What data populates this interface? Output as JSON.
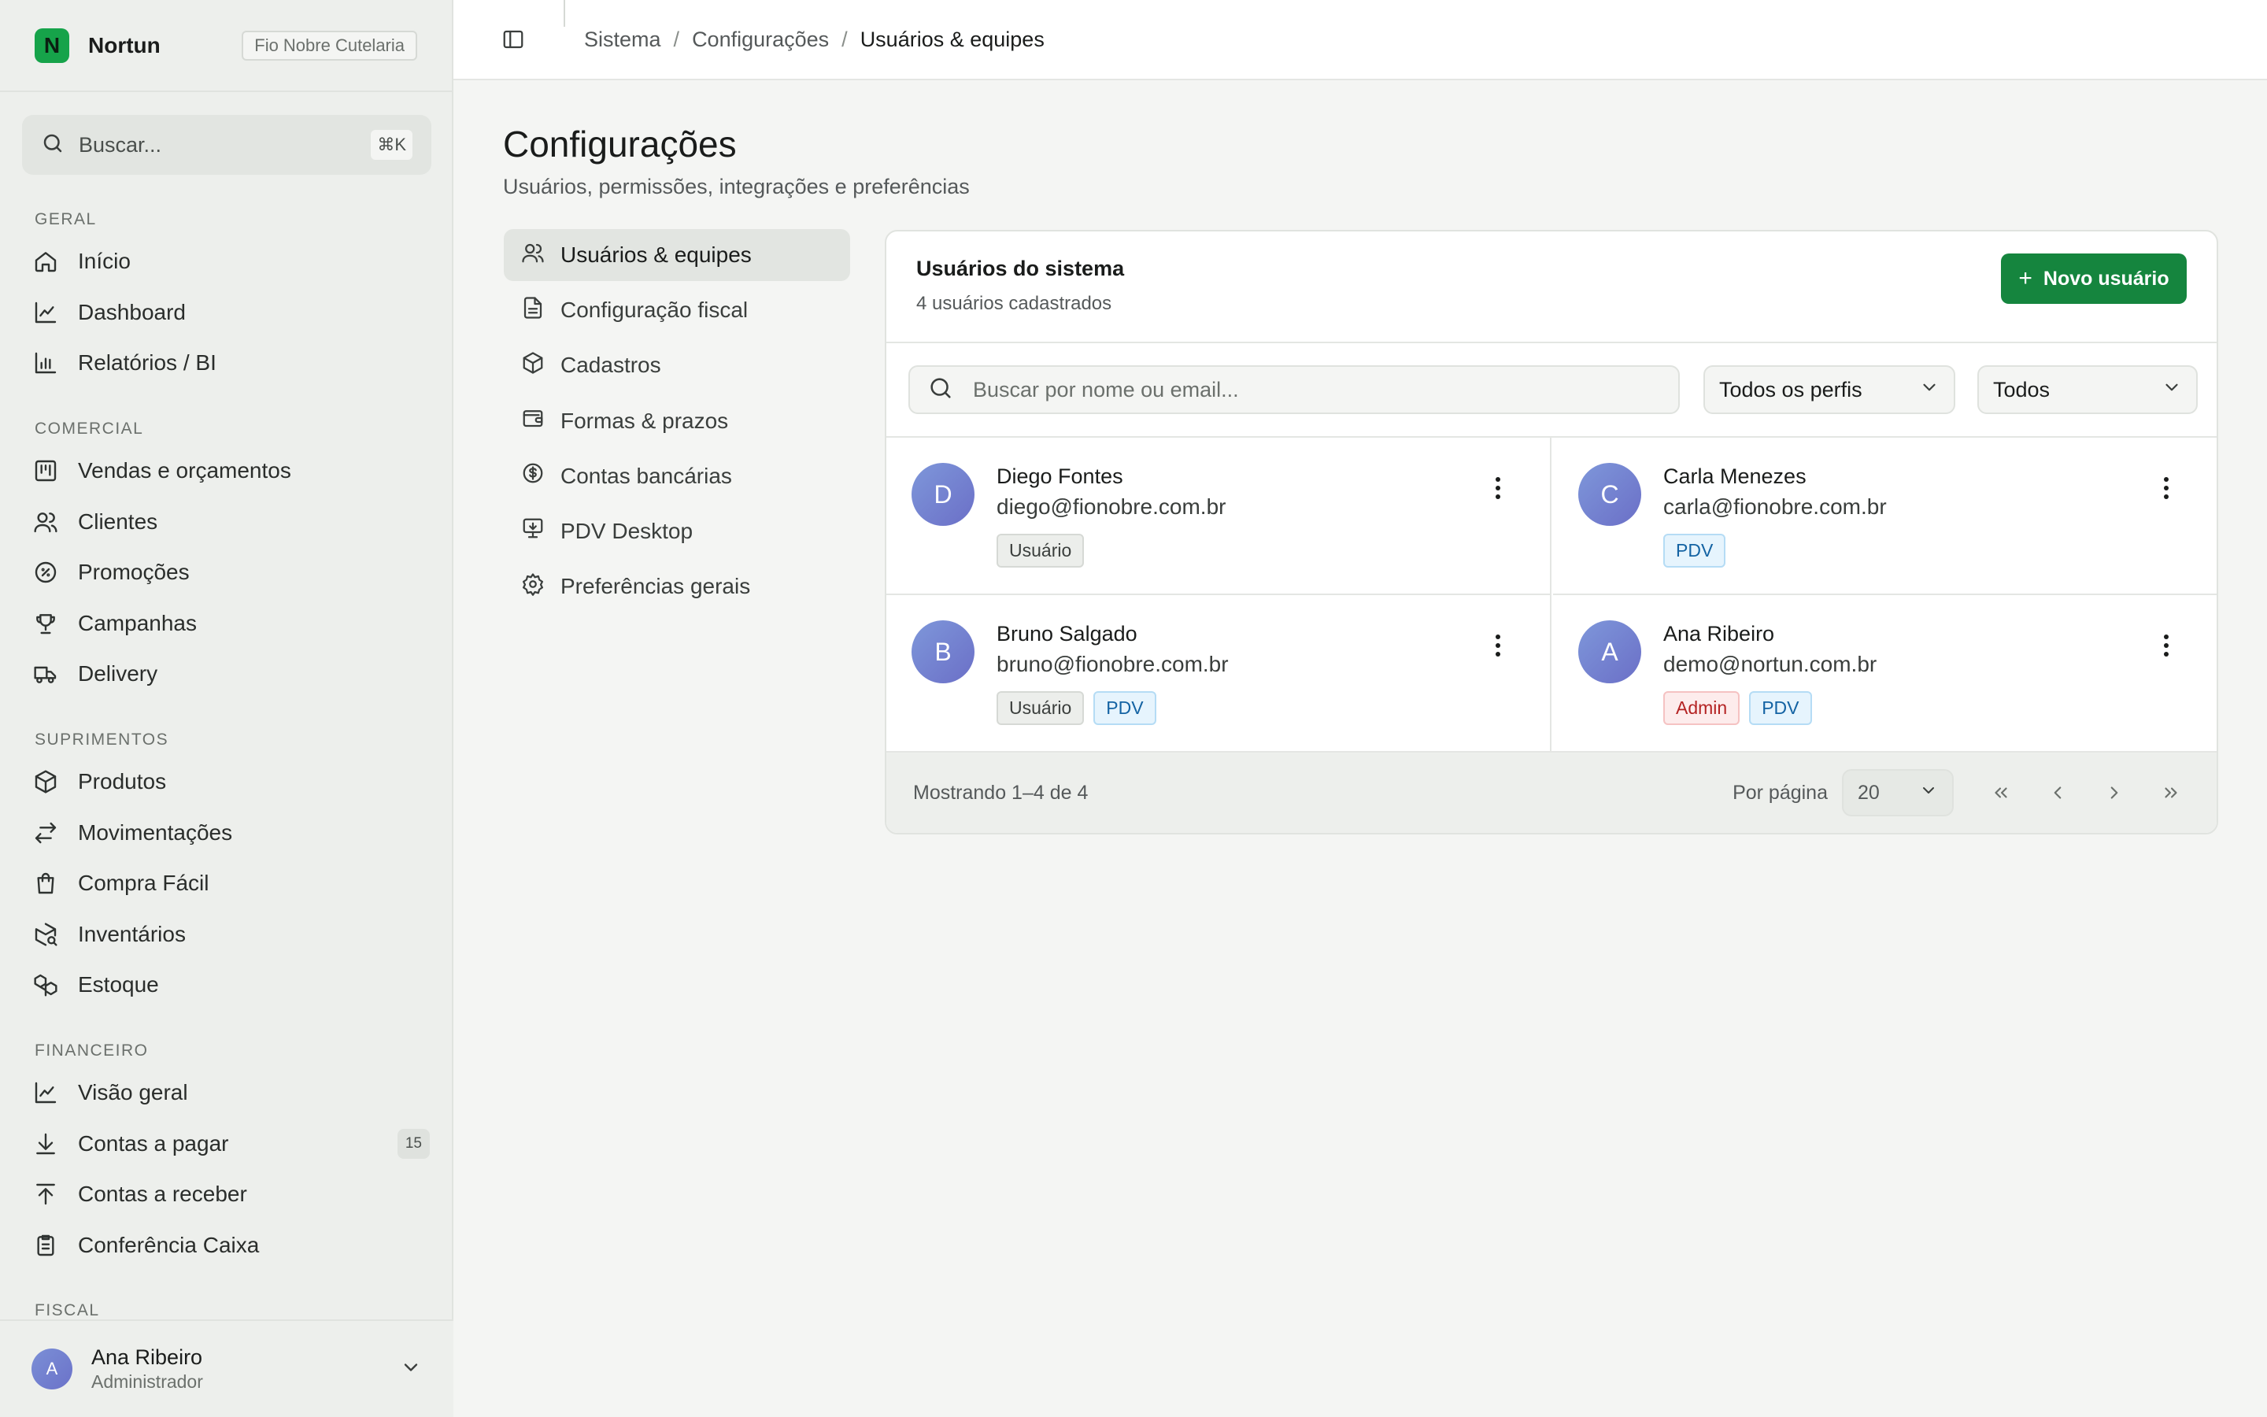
{
  "sidebar": {
    "brand_name": "Nortun",
    "brand_logo_letter": "N",
    "tenant": "Fio Nobre Cutelaria",
    "search_placeholder": "Buscar...",
    "search_shortcut": "⌘K",
    "sections": [
      {
        "title": "GERAL",
        "items": [
          {
            "label": "Início",
            "icon": "home-icon"
          },
          {
            "label": "Dashboard",
            "icon": "chart-line-icon"
          },
          {
            "label": "Relatórios / BI",
            "icon": "bar-chart-icon"
          }
        ]
      },
      {
        "title": "COMERCIAL",
        "items": [
          {
            "label": "Vendas e orçamentos",
            "icon": "kanban-icon"
          },
          {
            "label": "Clientes",
            "icon": "users-icon"
          },
          {
            "label": "Promoções",
            "icon": "percent-badge-icon"
          },
          {
            "label": "Campanhas",
            "icon": "trophy-icon"
          },
          {
            "label": "Delivery",
            "icon": "truck-icon"
          }
        ]
      },
      {
        "title": "SUPRIMENTOS",
        "items": [
          {
            "label": "Produtos",
            "icon": "package-icon"
          },
          {
            "label": "Movimentações",
            "icon": "arrows-left-right-icon"
          },
          {
            "label": "Compra Fácil",
            "icon": "shopping-bag-icon"
          },
          {
            "label": "Inventários",
            "icon": "package-search-icon"
          },
          {
            "label": "Estoque",
            "icon": "boxes-icon"
          }
        ]
      },
      {
        "title": "FINANCEIRO",
        "items": [
          {
            "label": "Visão geral",
            "icon": "chart-line-icon"
          },
          {
            "label": "Contas a pagar",
            "icon": "arrow-down-to-line-icon",
            "badge": "15"
          },
          {
            "label": "Contas a receber",
            "icon": "arrow-up-from-line-icon"
          },
          {
            "label": "Conferência Caixa",
            "icon": "clipboard-list-icon"
          }
        ]
      },
      {
        "title": "FISCAL",
        "items": []
      }
    ],
    "user": {
      "initial": "A",
      "name": "Ana Ribeiro",
      "role": "Administrador"
    }
  },
  "topbar": {
    "breadcrumb": [
      "Sistema",
      "Configurações",
      "Usuários & equipes"
    ]
  },
  "page": {
    "title": "Configurações",
    "subtitle": "Usuários, permissões, integrações e preferências"
  },
  "settings_nav": [
    {
      "label": "Usuários & equipes",
      "icon": "users-icon",
      "active": true
    },
    {
      "label": "Configuração fiscal",
      "icon": "file-text-icon"
    },
    {
      "label": "Cadastros",
      "icon": "box-icon"
    },
    {
      "label": "Formas & prazos",
      "icon": "wallet-icon"
    },
    {
      "label": "Contas bancárias",
      "icon": "dollar-circle-icon"
    },
    {
      "label": "PDV Desktop",
      "icon": "monitor-download-icon"
    },
    {
      "label": "Preferências gerais",
      "icon": "gear-icon"
    }
  ],
  "users_panel": {
    "title": "Usuários do sistema",
    "subtitle": "4 usuários cadastrados",
    "new_button": "Novo usuário",
    "search_placeholder": "Buscar por nome ou email...",
    "role_filter": "Todos os perfis",
    "status_filter": "Todos",
    "users": [
      {
        "initial": "D",
        "name": "Diego Fontes",
        "email": "diego@fionobre.com.br",
        "tags": [
          {
            "label": "Usuário",
            "kind": "user"
          }
        ]
      },
      {
        "initial": "C",
        "name": "Carla Menezes",
        "email": "carla@fionobre.com.br",
        "tags": [
          {
            "label": "PDV",
            "kind": "pdv"
          }
        ]
      },
      {
        "initial": "B",
        "name": "Bruno Salgado",
        "email": "bruno@fionobre.com.br",
        "tags": [
          {
            "label": "Usuário",
            "kind": "user"
          },
          {
            "label": "PDV",
            "kind": "pdv"
          }
        ]
      },
      {
        "initial": "A",
        "name": "Ana Ribeiro",
        "email": "demo@nortun.com.br",
        "tags": [
          {
            "label": "Admin",
            "kind": "admin"
          },
          {
            "label": "PDV",
            "kind": "pdv"
          }
        ]
      }
    ],
    "footer": {
      "showing": "Mostrando 1–4 de 4",
      "per_page_label": "Por página",
      "per_page_value": "20"
    }
  },
  "colors": {
    "accent": "#15853e",
    "brand": "#16a34a",
    "sidebar_bg": "#edefec",
    "pdv_tag": "#1463a3",
    "admin_tag": "#b42323"
  }
}
